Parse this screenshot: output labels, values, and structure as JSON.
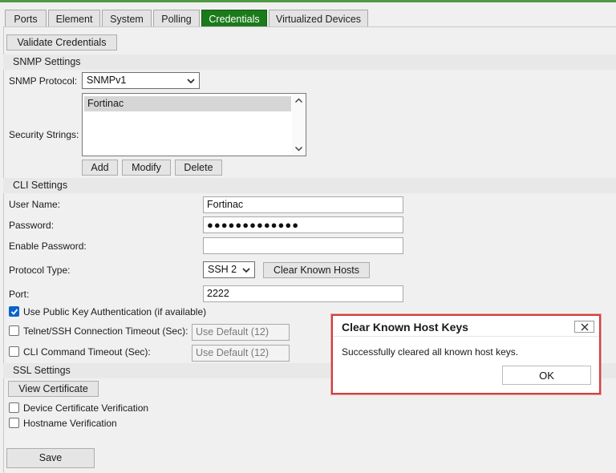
{
  "tabs": [
    {
      "label": "Ports",
      "active": false
    },
    {
      "label": "Element",
      "active": false
    },
    {
      "label": "System",
      "active": false
    },
    {
      "label": "Polling",
      "active": false
    },
    {
      "label": "Credentials",
      "active": true
    },
    {
      "label": "Virtualized Devices",
      "active": false
    }
  ],
  "toolbar": {
    "validate_label": "Validate Credentials"
  },
  "snmp": {
    "section_title": "SNMP Settings",
    "protocol_label": "SNMP Protocol:",
    "protocol_value": "SNMPv1",
    "security_strings_label": "Security Strings:",
    "security_strings": [
      "Fortinac"
    ],
    "add_label": "Add",
    "modify_label": "Modify",
    "delete_label": "Delete"
  },
  "cli": {
    "section_title": "CLI Settings",
    "username_label": "User Name:",
    "username_value": "Fortinac",
    "password_label": "Password:",
    "password_value": "●●●●●●●●●●●●●",
    "enable_password_label": "Enable Password:",
    "enable_password_value": "",
    "protocol_type_label": "Protocol Type:",
    "protocol_type_value": "SSH 2",
    "clear_hosts_label": "Clear Known Hosts",
    "port_label": "Port:",
    "port_value": "2222",
    "public_key_label": "Use Public Key Authentication (if available)",
    "public_key_checked": true,
    "conn_timeout_label": "Telnet/SSH Connection Timeout (Sec):",
    "conn_timeout_value": "Use Default (12)",
    "cmd_timeout_label": "CLI Command Timeout (Sec):",
    "cmd_timeout_value": "Use Default (12)"
  },
  "ssl": {
    "section_title": "SSL Settings",
    "view_cert_label": "View Certificate",
    "device_cert_label": "Device Certificate Verification",
    "hostname_label": "Hostname Verification"
  },
  "footer": {
    "save_label": "Save"
  },
  "dialog": {
    "title": "Clear Known Host Keys",
    "message": "Successfully cleared all known host keys.",
    "ok_label": "OK"
  },
  "colors": {
    "active_tab": "#1b7a1b",
    "dialog_border": "#d04040",
    "checkbox_checked": "#0a64c8"
  },
  "icons": [
    "chevron-down-icon",
    "chevron-up-icon",
    "close-icon",
    "checkmark-icon"
  ]
}
